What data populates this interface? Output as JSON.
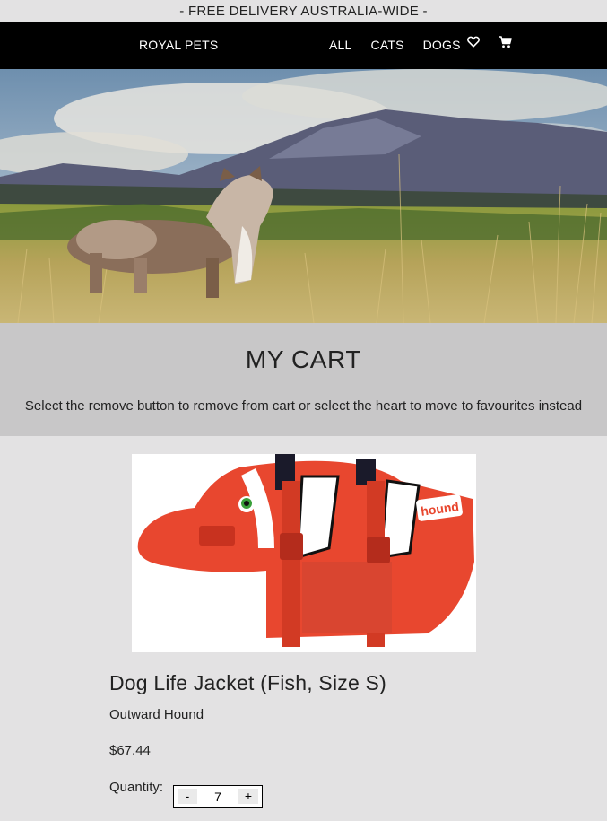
{
  "announcement": "- FREE DELIVERY AUSTRALIA-WIDE -",
  "nav": {
    "brand": "ROYAL PETS",
    "links": [
      "ALL",
      "CATS",
      "DOGS"
    ],
    "icons": [
      "heart-icon",
      "cart-icon"
    ]
  },
  "cart": {
    "title": "MY CART",
    "description": "Select the remove button to remove from cart or select the heart to move to favourites instead"
  },
  "item": {
    "name": "Dog Life Jacket (Fish, Size S)",
    "brand": "Outward Hound",
    "price": "$67.44",
    "quantity_label": "Quantity:",
    "quantity": "7",
    "decrement_label": "-",
    "increment_label": "+",
    "image_logo_text": "hound"
  }
}
